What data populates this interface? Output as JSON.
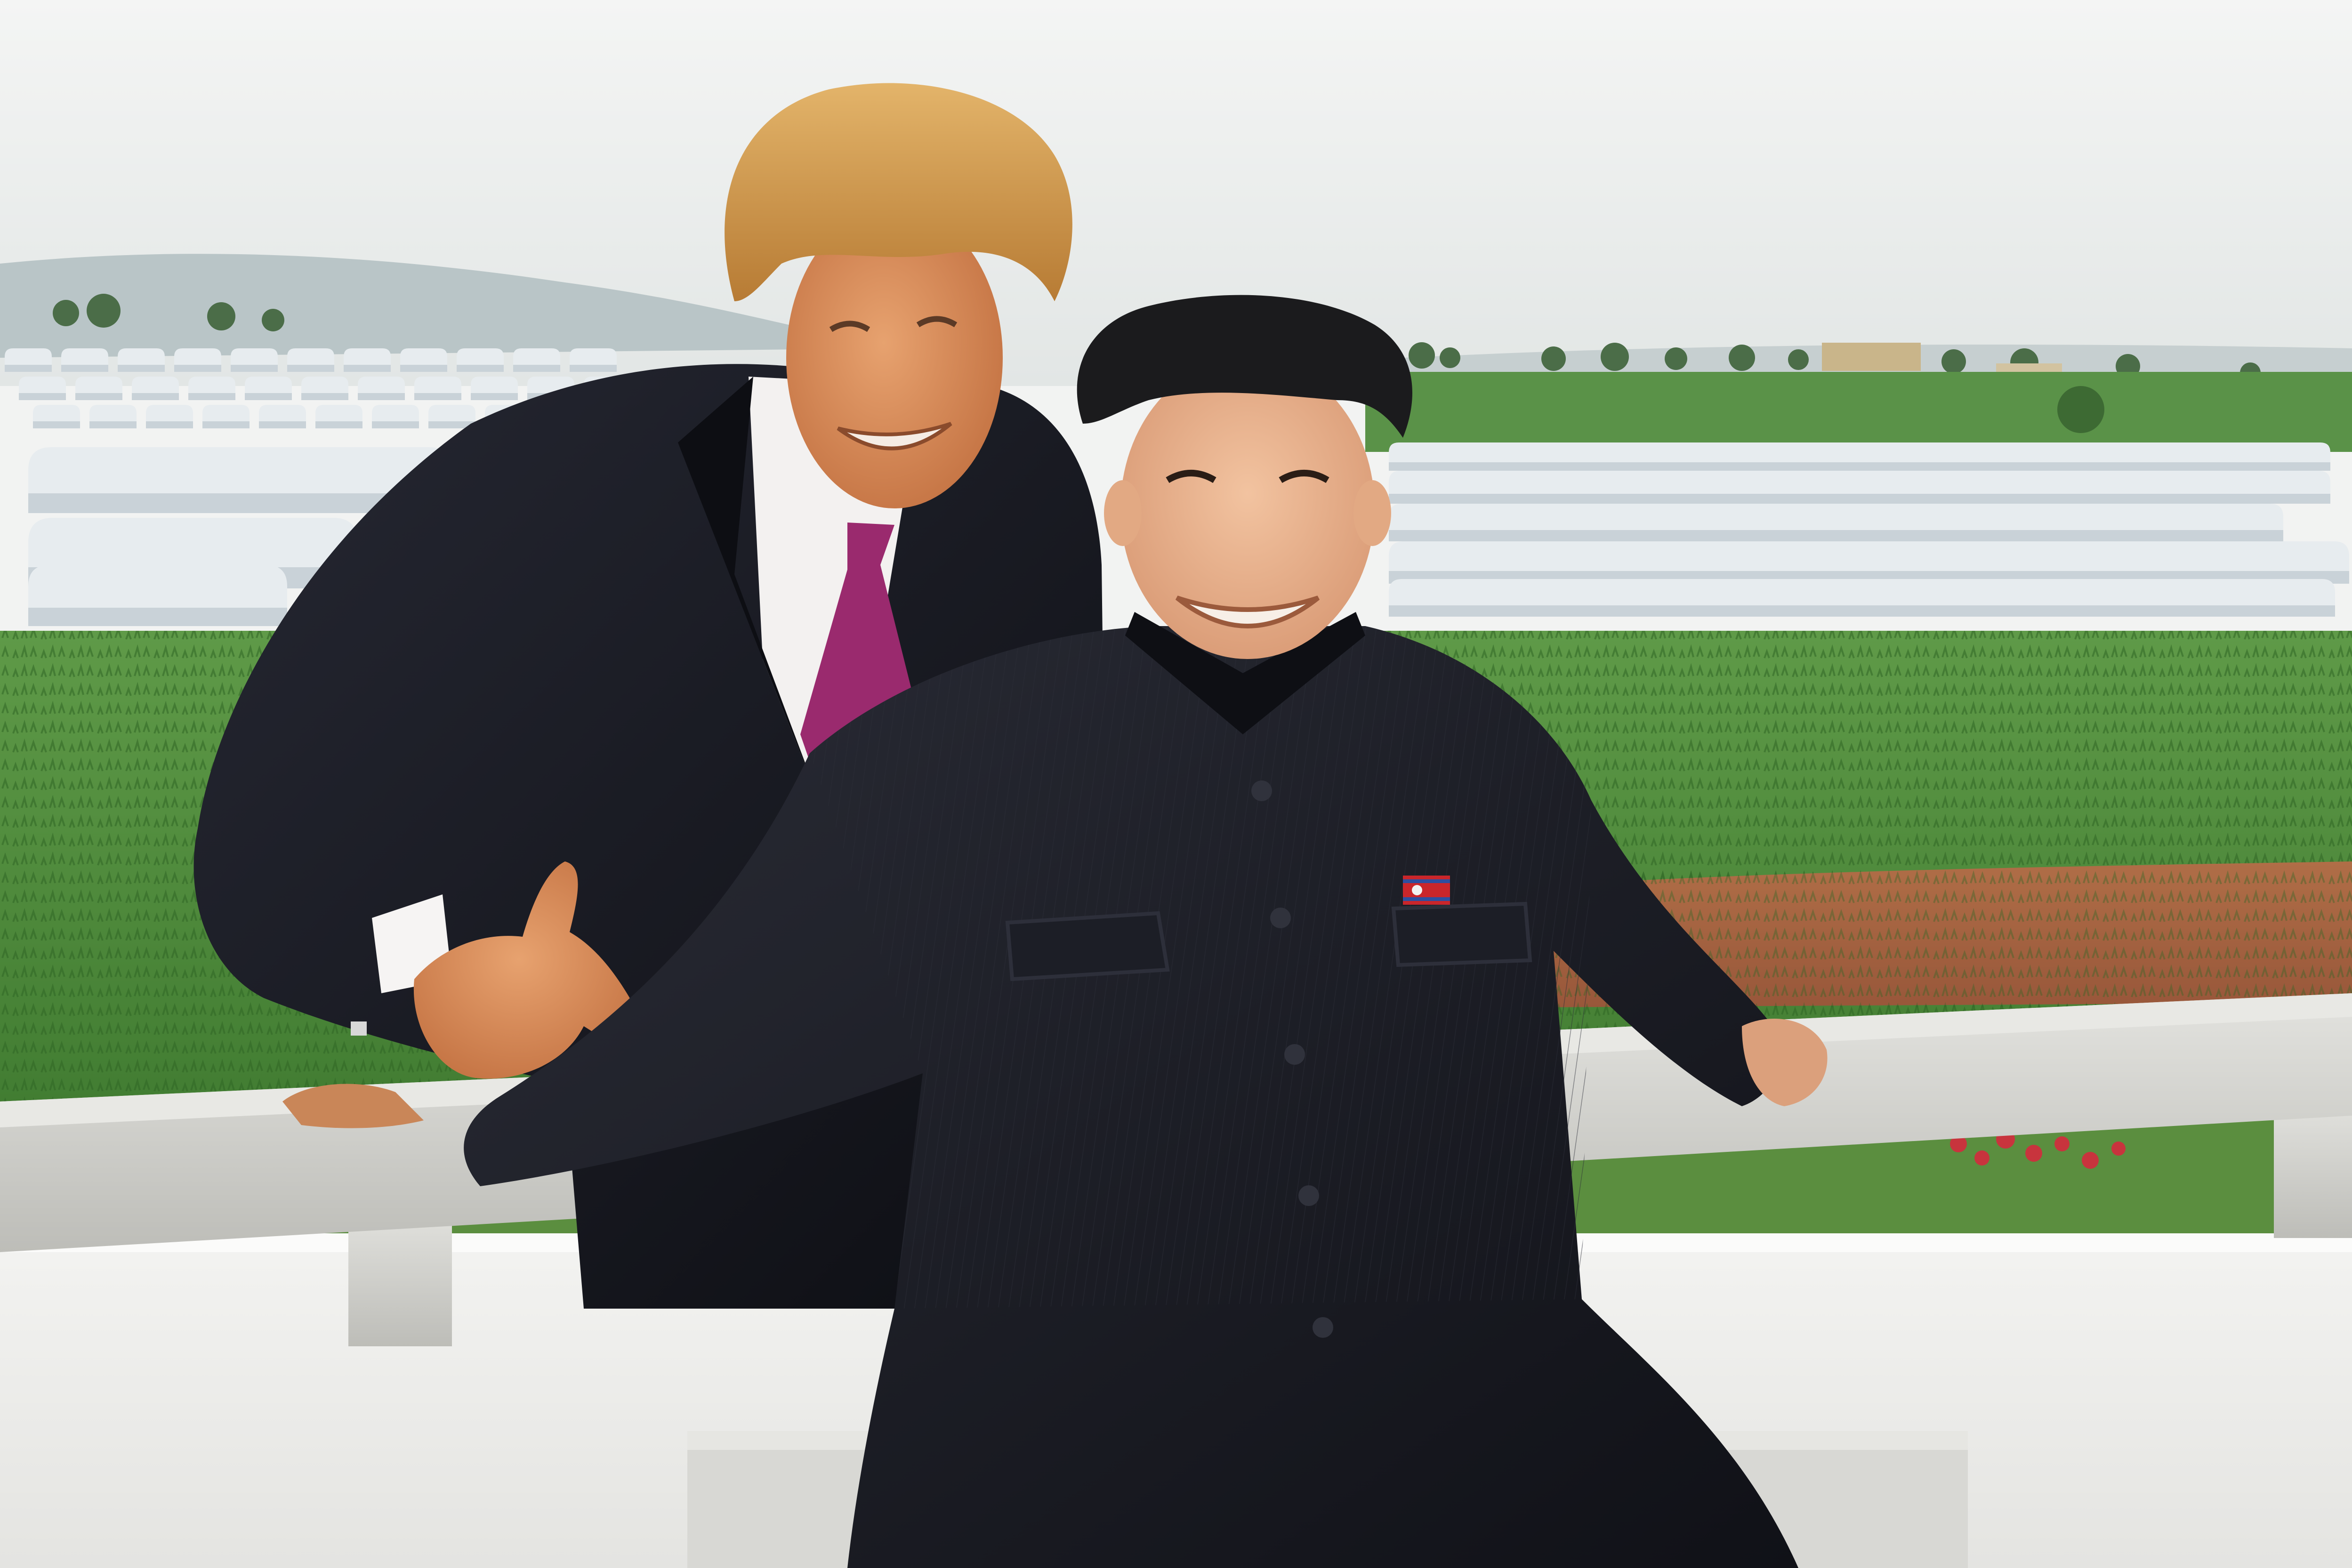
{
  "scene": {
    "palette": {
      "sky_top": "#f4f5f4",
      "sky_bottom": "#e3e7e6",
      "hills": "#b8c4c6",
      "field_green": "#4f8a3a",
      "field_green_dark": "#3a6e2c",
      "soil": "#a8643f",
      "greenhouse": "#e7ecef",
      "greenhouse_shadow": "#c9d2d8",
      "railing": "#d6d6d2",
      "wall": "#efefed",
      "suit_dark": "#15161c",
      "tie": "#9a2a6e",
      "shirt": "#f3f1f0",
      "hair_blond": "#d7a050",
      "hair_black": "#1b1b1d",
      "skin_tan": "#d98f5e",
      "skin_light": "#e9b48f",
      "pin_red": "#c9262b",
      "flower_red": "#c8343d"
    },
    "icons": {
      "pin": "flag-pin-icon"
    }
  }
}
